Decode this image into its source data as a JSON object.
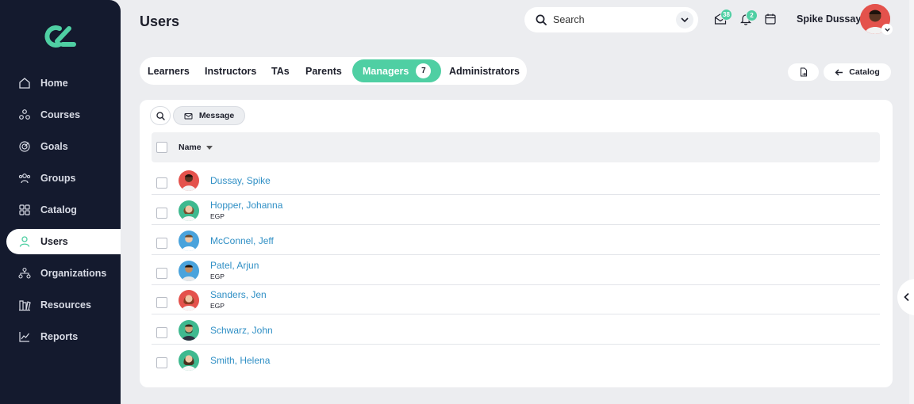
{
  "sidebar": {
    "items": [
      {
        "label": "Home",
        "icon": "home-icon"
      },
      {
        "label": "Courses",
        "icon": "courses-icon"
      },
      {
        "label": "Goals",
        "icon": "goals-icon"
      },
      {
        "label": "Groups",
        "icon": "groups-icon"
      },
      {
        "label": "Catalog",
        "icon": "catalog-icon"
      },
      {
        "label": "Users",
        "icon": "user-icon"
      },
      {
        "label": "Organizations",
        "icon": "organizations-icon"
      },
      {
        "label": "Resources",
        "icon": "resources-icon"
      },
      {
        "label": "Reports",
        "icon": "reports-icon"
      }
    ],
    "active": "Users"
  },
  "header": {
    "title": "Users",
    "search_placeholder": "Search",
    "inbox_count": "38",
    "notification_count": "2",
    "user_name": "Spike Dussay"
  },
  "tabs": [
    {
      "label": "Learners"
    },
    {
      "label": "Instructors"
    },
    {
      "label": "TAs"
    },
    {
      "label": "Parents"
    },
    {
      "label": "Managers",
      "count": "7"
    },
    {
      "label": "Administrators"
    }
  ],
  "actions": {
    "catalog_label": "Catalog",
    "message_label": "Message"
  },
  "table": {
    "column_name": "Name",
    "rows": [
      {
        "name": "Dussay, Spike",
        "sub": ""
      },
      {
        "name": "Hopper, Johanna",
        "sub": "EGP"
      },
      {
        "name": "McConnel, Jeff",
        "sub": ""
      },
      {
        "name": "Patel, Arjun",
        "sub": "EGP"
      },
      {
        "name": "Sanders, Jen",
        "sub": "EGP"
      },
      {
        "name": "Schwarz, John",
        "sub": ""
      },
      {
        "name": "Smith, Helena",
        "sub": ""
      }
    ]
  },
  "colors": {
    "sidebar_bg": "#141a2e",
    "accent": "#4fcfa3",
    "link": "#2f8fc5"
  }
}
